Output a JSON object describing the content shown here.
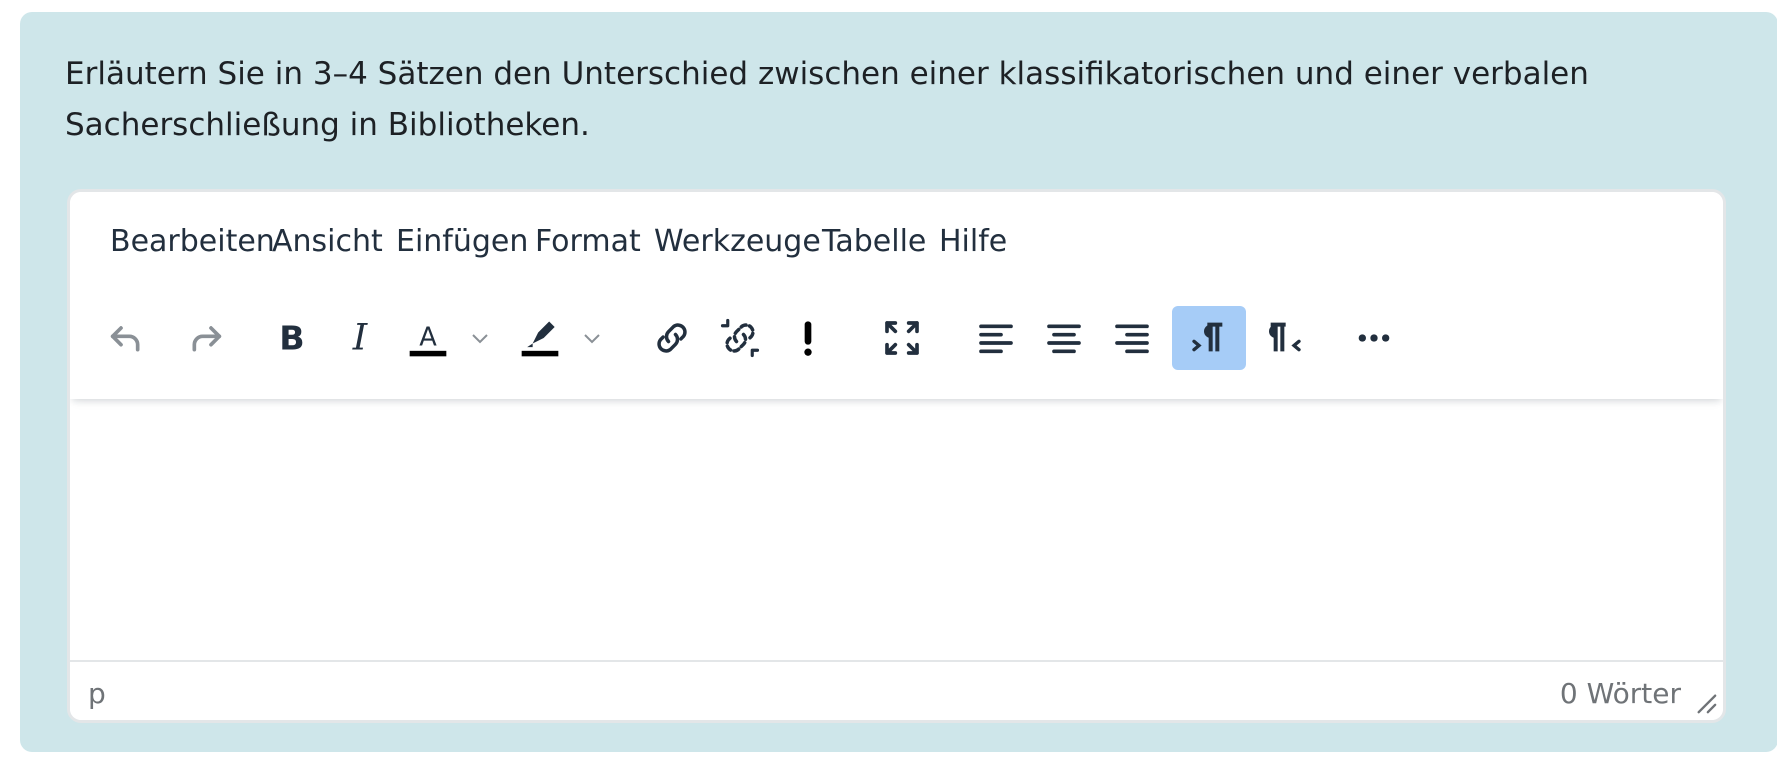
{
  "question": {
    "text": "Erläutern Sie in 3–4 Sätzen den Unterschied zwischen einer klassifikatorischen und einer verbalen Sacherschließung in Bibliotheken."
  },
  "editor": {
    "menubar": [
      "Bearbeiten",
      "Ansicht",
      "Einfügen",
      "Format",
      "Werkzeuge",
      "Tabelle",
      "Hilfe"
    ],
    "toolbar": [
      {
        "name": "undo-icon",
        "state": "disabled"
      },
      {
        "name": "redo-icon",
        "state": "disabled"
      },
      {
        "name": "bold-icon"
      },
      {
        "name": "italic-icon"
      },
      {
        "name": "text-color-icon",
        "letter": "A"
      },
      {
        "name": "chevron-down-icon"
      },
      {
        "name": "highlight-color-icon"
      },
      {
        "name": "chevron-down-icon"
      },
      {
        "name": "link-icon"
      },
      {
        "name": "unlink-icon"
      },
      {
        "name": "exclamation-icon"
      },
      {
        "name": "fullscreen-icon"
      },
      {
        "name": "align-left-icon"
      },
      {
        "name": "align-center-icon"
      },
      {
        "name": "align-right-icon"
      },
      {
        "name": "ltr-icon",
        "state": "active"
      },
      {
        "name": "rtl-icon"
      },
      {
        "name": "more-icon"
      }
    ],
    "content": "",
    "status": {
      "path": "p",
      "word_count": "0 Wörter"
    }
  },
  "colors": {
    "panel_bg": "#cee6ea",
    "active_button": "#a6ccf7",
    "icon": "#222f3e",
    "icon_disabled": "#8a9096"
  }
}
